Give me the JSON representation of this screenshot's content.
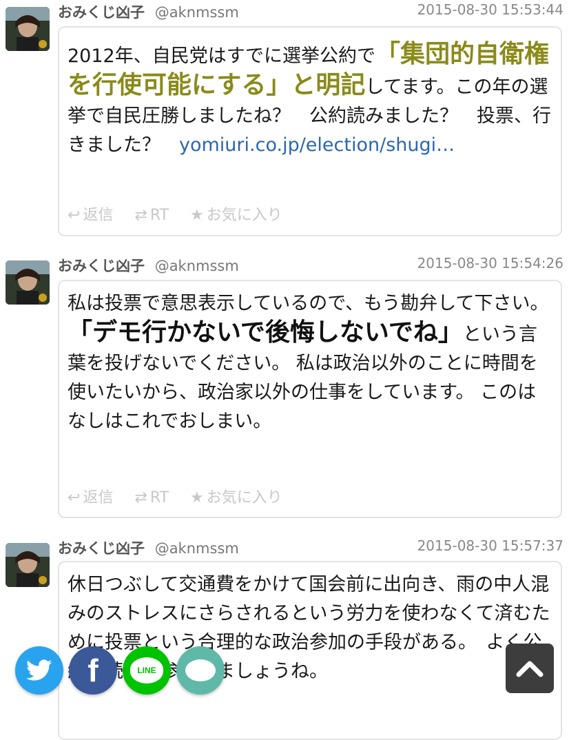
{
  "tweets": [
    {
      "name": "おみくじ凶子",
      "handle": "@aknmssm",
      "timestamp": "2015-08-30 15:53:44",
      "text_pre": "2012年、自民党はすでに選挙公約で",
      "text_highlight": "「集団的自衛権を行使可能にする」と明記",
      "text_post": "してます。この年の選挙で自民圧勝しましたね？　公約読みました？　投票、行きました？　",
      "link": "yomiuri.co.jp/election/shugi…"
    },
    {
      "name": "おみくじ凶子",
      "handle": "@aknmssm",
      "timestamp": "2015-08-30 15:54:26",
      "text_pre": "私は投票で意思表示しているので、もう勘弁して下さい。",
      "text_highlight": "「デモ行かないで後悔しないでね」",
      "text_post": "という言葉を投げないでください。 私は政治以外のことに時間を使いたいから、政治家以外の仕事をしています。 このはなしはこれでおしまい。"
    },
    {
      "name": "おみくじ凶子",
      "handle": "@aknmssm",
      "timestamp": "2015-08-30 15:57:37",
      "text": "休日つぶして交通費をかけて国会前に出向き、雨の中人混みのストレスにさらされるという労力を使わなくて済むために投票という合理的な政治参加の手段がある。　よく公約を読み、参加しましょうね。"
    }
  ],
  "actions": {
    "reply": "返信",
    "retweet": "RT",
    "favorite": "お気に入り"
  },
  "icons": {
    "reply": "reply-icon",
    "retweet": "retweet-icon",
    "favorite": "star-icon"
  },
  "share": {
    "twitter_color": "#2aa3ef",
    "facebook_color": "#3b5998",
    "line_color": "#00c300",
    "comment_color": "#5fb8a8",
    "line_label": "LINE"
  },
  "colors": {
    "highlight_olive": "#8a8a1a",
    "link": "#2a66b0",
    "timestamp": "#888888"
  }
}
